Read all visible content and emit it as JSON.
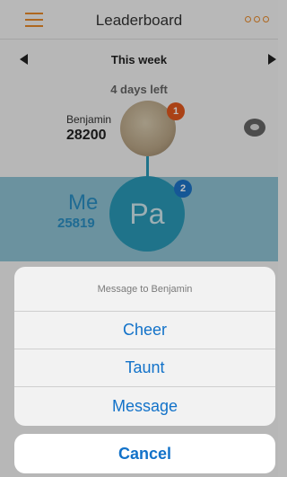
{
  "header": {
    "title": "Leaderboard"
  },
  "week": {
    "label": "This week",
    "days_left": "4 days left"
  },
  "rival": {
    "name": "Benjamin",
    "score": "28200",
    "rank": "1"
  },
  "me": {
    "label": "Me",
    "score": "25819",
    "initials": "Pa",
    "rank": "2"
  },
  "action_sheet": {
    "title": "Message to Benjamin",
    "options": [
      "Cheer",
      "Taunt",
      "Message"
    ],
    "cancel": "Cancel"
  },
  "colors": {
    "accent": "#e88a2a",
    "link": "#1272c9",
    "me_row": "#8fc3d4",
    "rank1": "#e3581e",
    "rank2": "#1d74c9"
  },
  "icons": [
    "hamburger-icon",
    "more-dots-icon",
    "arrow-left-icon",
    "arrow-right-icon",
    "chat-bubble-icon"
  ]
}
